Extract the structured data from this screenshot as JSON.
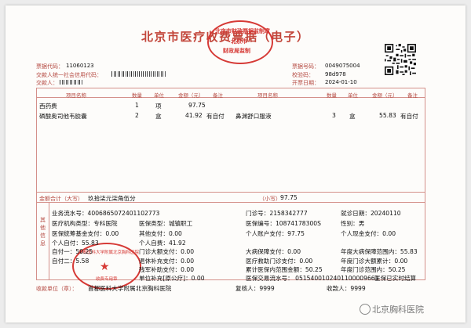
{
  "title": "北京市医疗收费票据（电子）",
  "header": {
    "code_label": "票据代码：",
    "code_value": "11060123",
    "payer_label": "交款人统一社会信用代码：",
    "payer2_label": "交款人：",
    "number_label": "票据号码：",
    "number_value": "0049075004",
    "check_label": "校验码：",
    "check_value": "98d978",
    "date_label": "开票日期：",
    "date_value": "2024-01-10"
  },
  "seal_top": {
    "outer": "北京市财政票据监制章",
    "mid": "北京市",
    "inner": "财政局监制"
  },
  "items_header": [
    "项目名称",
    "数量",
    "单位",
    "金额（元）",
    "备注",
    "项目名称",
    "数量",
    "单位",
    "金额（元）",
    "备注"
  ],
  "items": [
    {
      "name": "西药费",
      "qty": "1",
      "unit": "项",
      "amount": "97.75",
      "note": ""
    },
    {
      "name": "磷酸奥司他韦胶囊",
      "qty": "2",
      "unit": "盒",
      "amount": "41.92",
      "note": "有自付"
    }
  ],
  "items_right": [
    {
      "name": "鼻渊舒口服液",
      "qty": "3",
      "unit": "盒",
      "amount": "55.83",
      "note": "有自付"
    }
  ],
  "total": {
    "label": "金额合计（大写）",
    "upper": "玖拾柒元柒角伍分",
    "small_label": "（小写）",
    "small": "97.75"
  },
  "other_label": "其他信息",
  "info": {
    "serial": "业务流水号：4006865072401102773",
    "outpatient": "门诊号：2158342777",
    "visit_date": "就诊日期：20240110",
    "institution": "医疗机构类型：专科医院",
    "insurance_type": "医保类型：城镇职工",
    "insurance_no": "医保编号：10874178300S",
    "gender": "性别：男",
    "fund_pay": "医保统筹基金支付：0.00",
    "other_pay": "其他支付：0.00",
    "account_pay": "个人账户支付：97.75",
    "cash_pay": "个人现金支付：0.00",
    "self_pay": "个人自付：55.83",
    "self_cost": "个人自费：41.92",
    "self_one": "自付一：50.25",
    "big_pay": "门诊大额支付：0.00",
    "sick_pay": "大病保障支付：0.00",
    "annual_big": "年度大病保障范围内：55.83",
    "self_two": "自付二：5.58",
    "retire_pay": "退休补充支付：0.00",
    "rescue_pay": "医疗救助门诊支付：0.00",
    "annual_clinic": "年度门诊大额累计：0.00",
    "disabled_pay": "残军补助支付：0.00",
    "self_pay_range": "累计医保内范围金额：50.25",
    "annual_range": "年度门诊范围内：50.25",
    "unit_pay": "单位补充[原公疗]：0.00",
    "trade": "医保交易流水号：  0515400102401100009661",
    "realtime": "医保已实时结算"
  },
  "footer": {
    "unit_label": "收款单位（章）：",
    "unit_value": "首都医科大学附属北京胸科医院",
    "reviewer": "复核人：9999",
    "payee": "收款人：9999"
  },
  "seal_bottom": {
    "text": "首都医科大学附属北京胸科医院",
    "sub": "收费专用章"
  },
  "watermark": "北京胸科医院",
  "colors": {
    "label": "#b54a42",
    "seal": "#d63a36",
    "line": "#d4908a"
  }
}
